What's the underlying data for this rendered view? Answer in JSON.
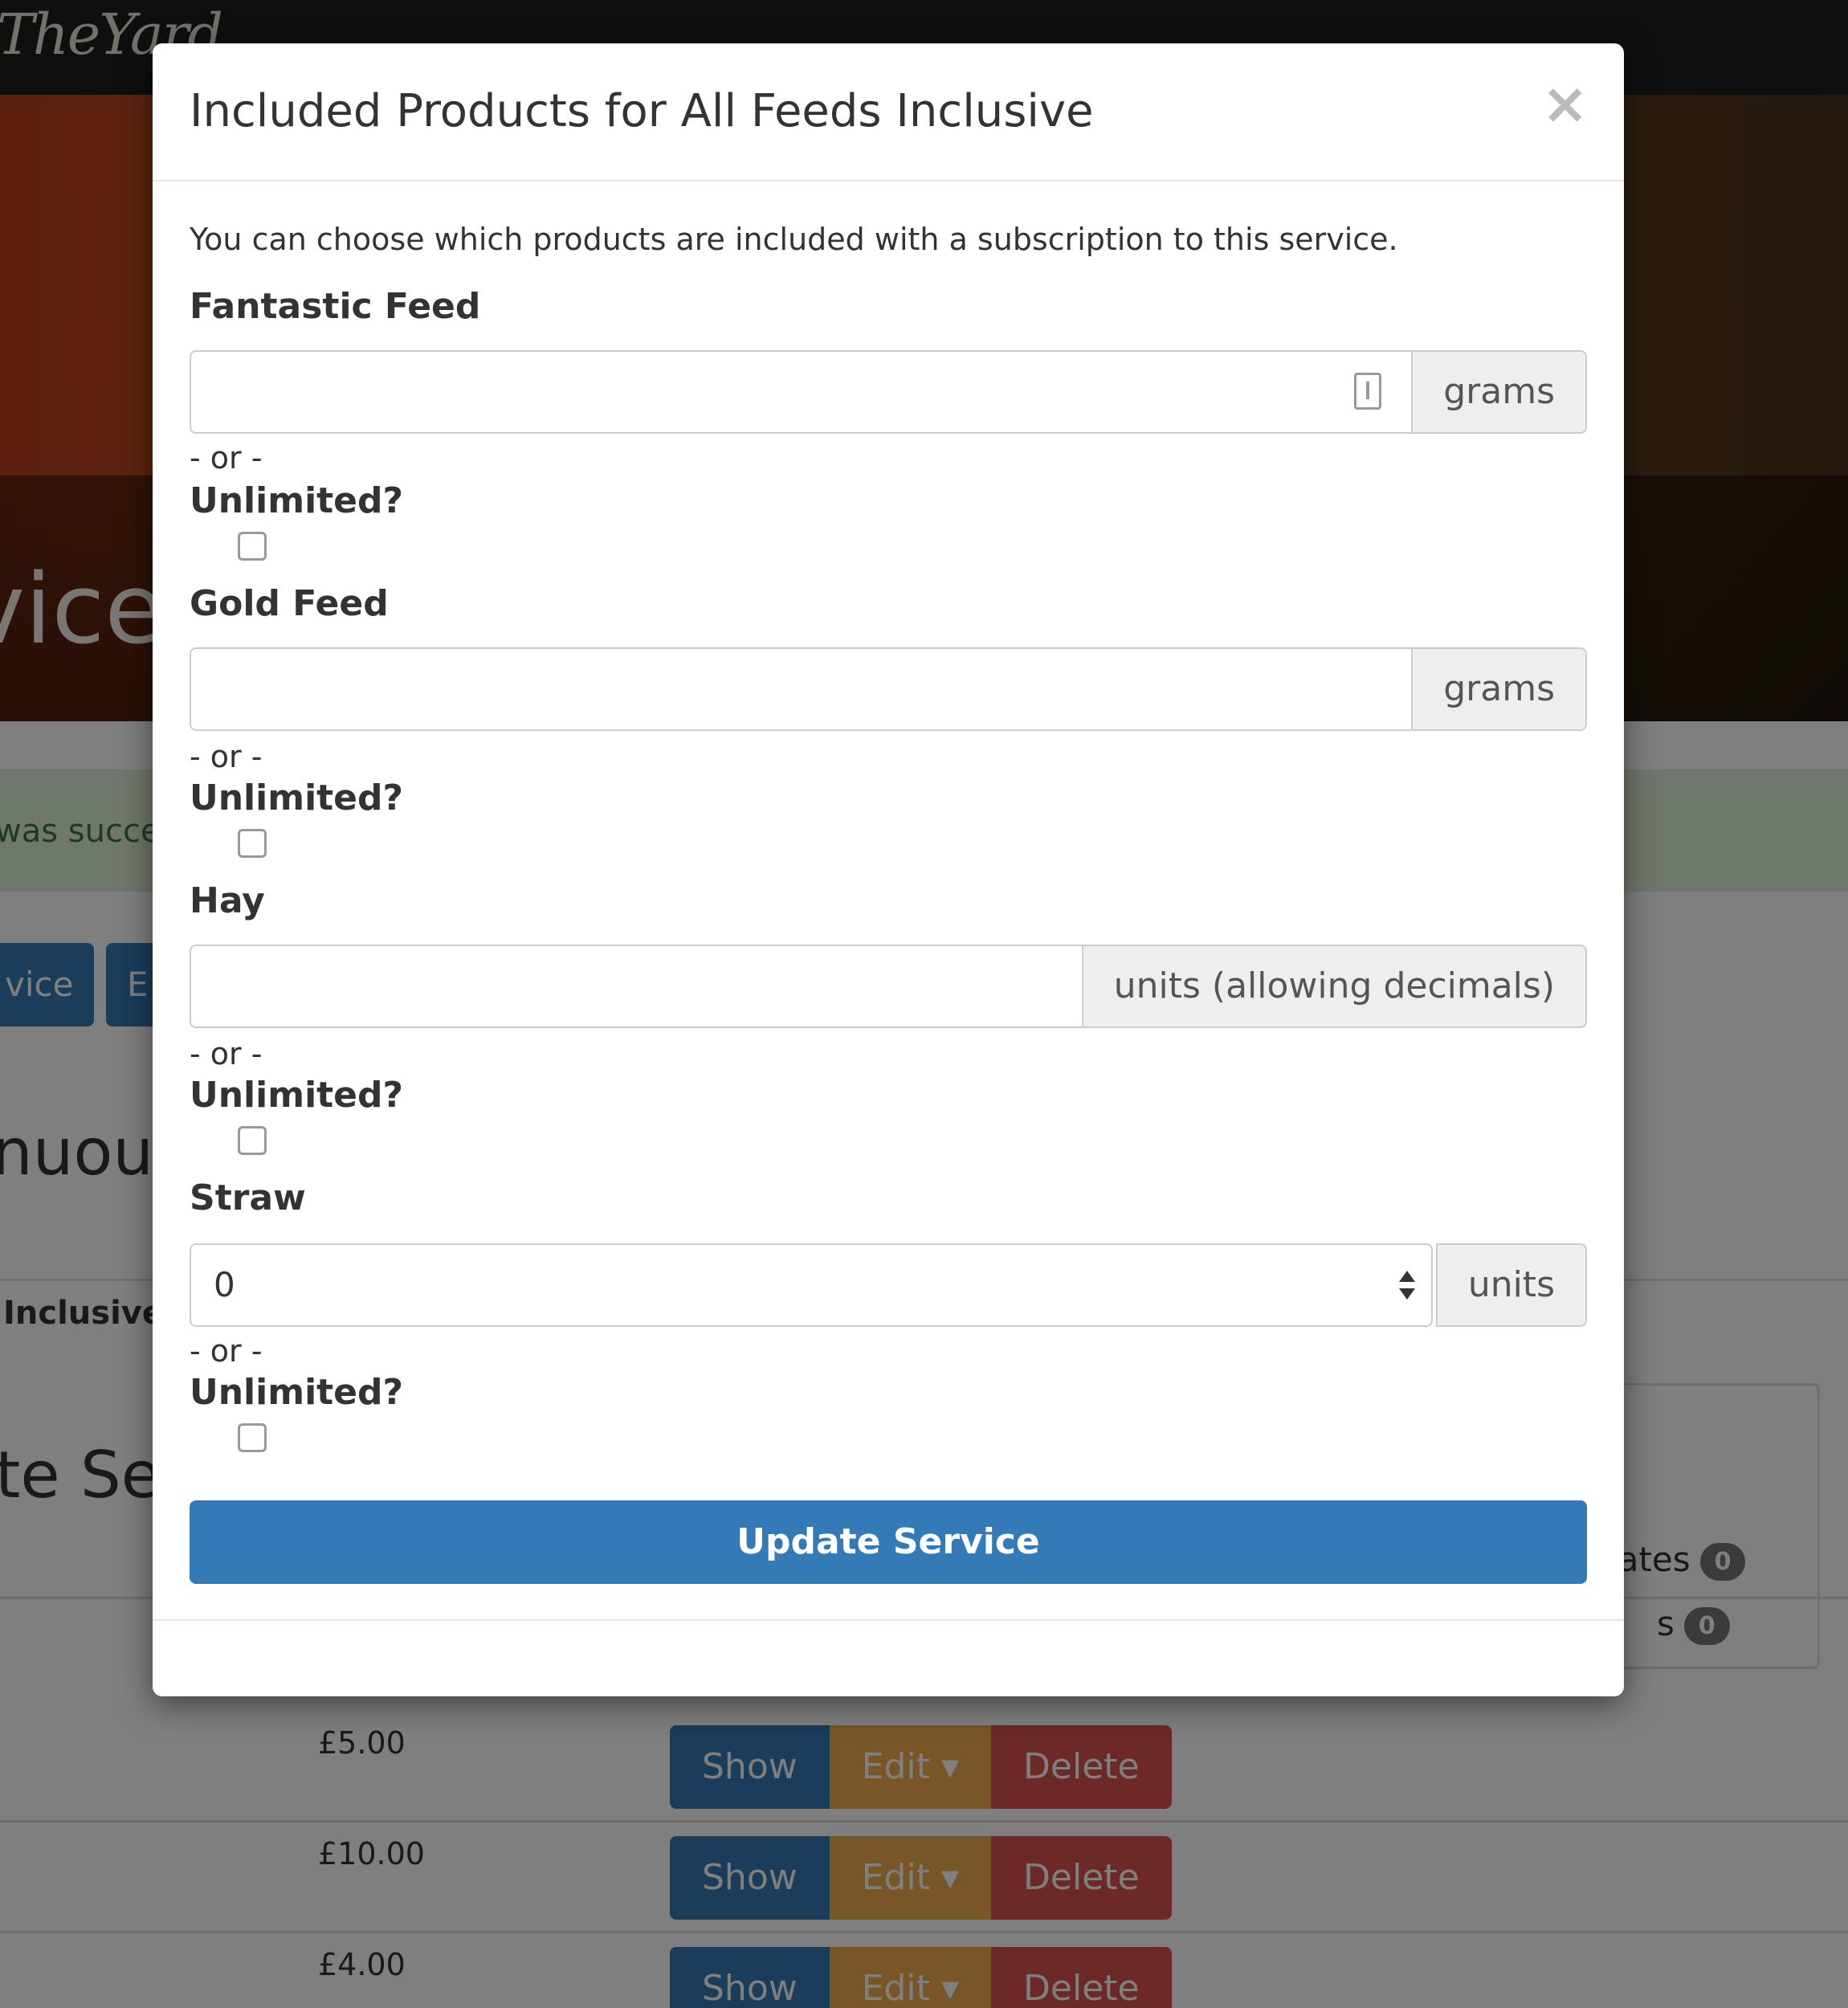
{
  "background": {
    "brand": "TheYard",
    "hero_title": "vices",
    "alert_text": "was succe",
    "buttons": [
      "vice",
      "E"
    ],
    "heading_1": "nuous",
    "label": "Inclusive",
    "heading_2": "te Se",
    "panel_items": [
      {
        "label": "lates",
        "count": "0"
      },
      {
        "label": "s",
        "count": "0"
      }
    ],
    "rows": [
      {
        "price": "£5.00",
        "show": "Show",
        "edit": "Edit",
        "delete": "Delete"
      },
      {
        "price": "£10.00",
        "show": "Show",
        "edit": "Edit",
        "delete": "Delete"
      },
      {
        "price": "£4.00",
        "show": "Show",
        "edit": "Edit",
        "delete": "Delete"
      }
    ]
  },
  "modal": {
    "title": "Included Products for All Feeds Inclusive",
    "close": "×",
    "intro": "You can choose which products are included with a subscription to this service.",
    "products": [
      {
        "name": "Fantastic Feed",
        "value": "",
        "unit": "grams",
        "or": "- or -",
        "unlimited_label": "Unlimited?",
        "unlimited": false
      },
      {
        "name": "Gold Feed",
        "value": "",
        "unit": "grams",
        "or": "- or -",
        "unlimited_label": "Unlimited?",
        "unlimited": false
      },
      {
        "name": "Hay",
        "value": "",
        "unit": "units (allowing decimals)",
        "or": "- or -",
        "unlimited_label": "Unlimited?",
        "unlimited": false
      },
      {
        "name": "Straw",
        "value": "0",
        "unit": "units",
        "or": "- or -",
        "unlimited_label": "Unlimited?",
        "unlimited": false
      }
    ],
    "submit": "Update Service"
  }
}
